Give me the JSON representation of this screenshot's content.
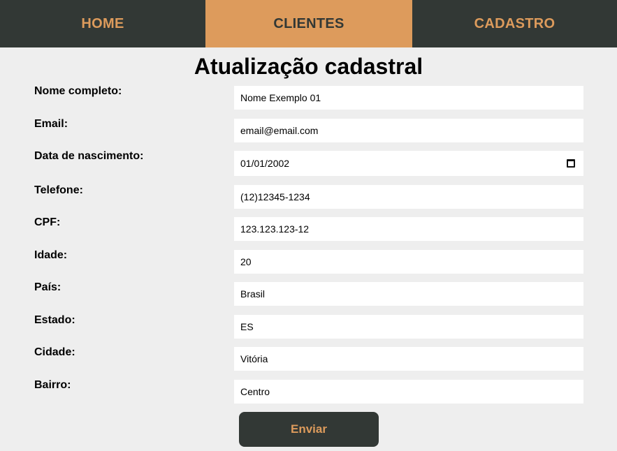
{
  "nav": {
    "home": "HOME",
    "clientes": "CLIENTES",
    "cadastro": "CADASTRO"
  },
  "page": {
    "title": "Atualização cadastral"
  },
  "form": {
    "nome": {
      "label": "Nome completo:",
      "value": "Nome Exemplo 01"
    },
    "email": {
      "label": "Email:",
      "value": "email@email.com"
    },
    "nascimento": {
      "label": "Data de nascimento:",
      "value": "01/01/2002"
    },
    "telefone": {
      "label": "Telefone:",
      "value": "(12)12345-1234"
    },
    "cpf": {
      "label": "CPF:",
      "value": "123.123.123-12"
    },
    "idade": {
      "label": "Idade:",
      "value": "20"
    },
    "pais": {
      "label": "País:",
      "value": "Brasil"
    },
    "estado": {
      "label": "Estado:",
      "value": "ES"
    },
    "cidade": {
      "label": "Cidade:",
      "value": "Vitória"
    },
    "bairro": {
      "label": "Bairro:",
      "value": "Centro"
    },
    "submit_label": "Enviar"
  },
  "icons": {
    "date_picker": "calendar-icon"
  },
  "colors": {
    "nav_bg": "#323835",
    "accent": "#dd9b5c",
    "page_bg": "#eeeeee"
  }
}
